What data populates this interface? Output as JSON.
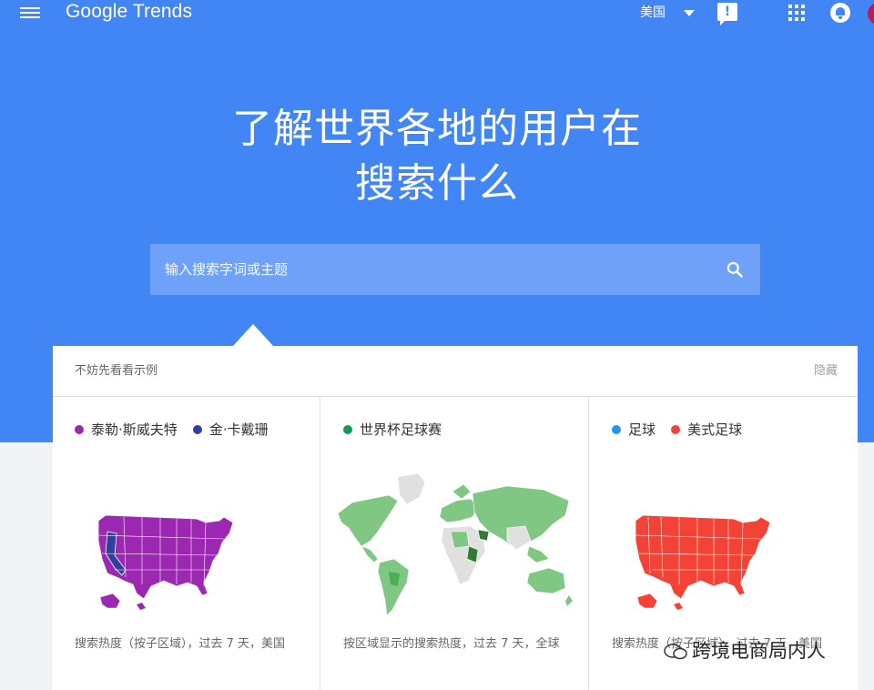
{
  "header": {
    "logo": "Google Trends",
    "region": "美国",
    "feedback_icon_label": "!"
  },
  "hero": {
    "title_line1": "了解世界各地的用户在",
    "title_line2": "搜索什么"
  },
  "search": {
    "placeholder": "输入搜索字词或主题"
  },
  "examples": {
    "title": "不妨先看看示例",
    "hide_label": "隐藏",
    "cards": [
      {
        "legend": [
          {
            "label": "泰勒·斯威夫特",
            "color": "#9c27b0"
          },
          {
            "label": "金·卡戴珊",
            "color": "#303f9f"
          }
        ],
        "caption": "搜索热度（按子区域），过去 7 天，美国"
      },
      {
        "legend": [
          {
            "label": "世界杯足球赛",
            "color": "#0f9d58"
          }
        ],
        "caption": "按区域显示的搜索热度，过去 7 天，全球"
      },
      {
        "legend": [
          {
            "label": "足球",
            "color": "#2196f3"
          },
          {
            "label": "美式足球",
            "color": "#f44336"
          }
        ],
        "caption": "搜索热度（按子区域），过去 7 天，美国"
      }
    ]
  },
  "colors": {
    "hero_blue": "#4285f4",
    "search_bg": "#6ea1f7",
    "map_purple": "#9c27b0",
    "map_navy": "#303f9f",
    "map_green": "#81c784",
    "map_dark_green": "#2e7d32",
    "map_red": "#f44336",
    "map_grey": "#e0e0e0"
  },
  "watermark": {
    "text": "跨境电商局内人"
  }
}
